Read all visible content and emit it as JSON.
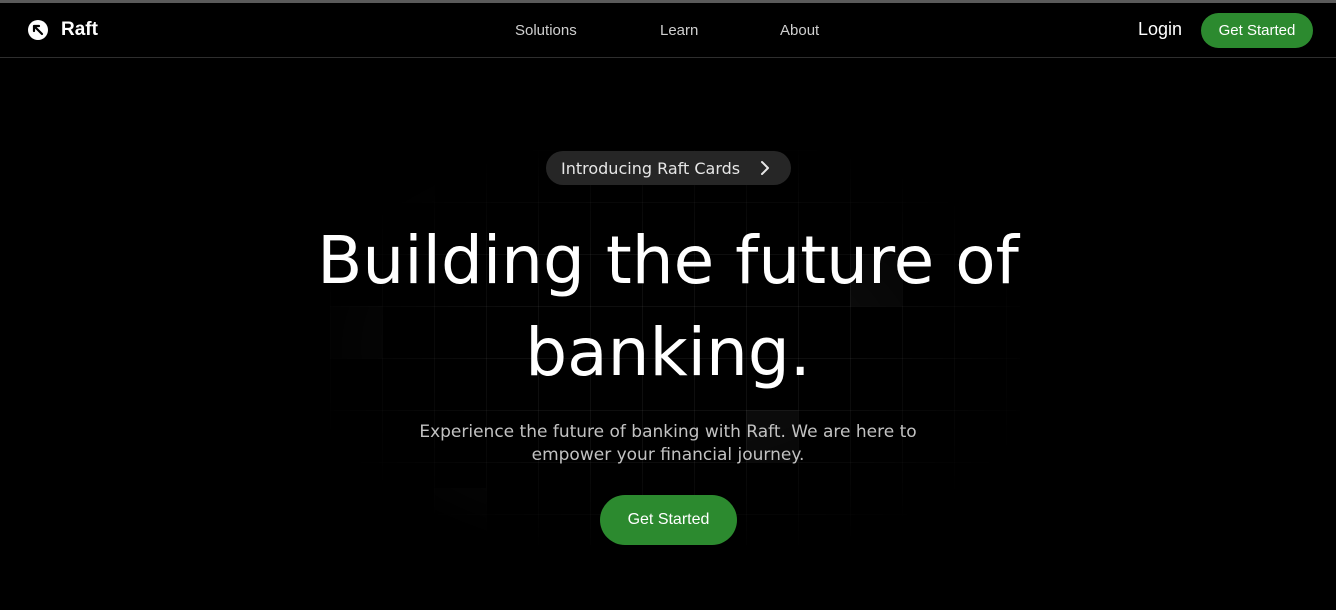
{
  "nav": {
    "brand": "Raft",
    "brand_icon": "raft-logo-icon",
    "links": [
      "Solutions",
      "Learn",
      "About"
    ],
    "login_label": "Login",
    "cta_label": "Get Started"
  },
  "hero": {
    "announcement": "Introducing Raft Cards",
    "announcement_icon": "chevron-right-icon",
    "headline_line1": "Building the future of",
    "headline_line2": "banking.",
    "subtext": "Experience the future of banking with Raft. We are here to empower your financial journey.",
    "cta_label": "Get Started"
  },
  "colors": {
    "background": "#000000",
    "accent": "#2c8a2f",
    "pill_bg": "#262626",
    "nav_link": "#cfcfcf",
    "subtext": "#c2c2c2"
  }
}
